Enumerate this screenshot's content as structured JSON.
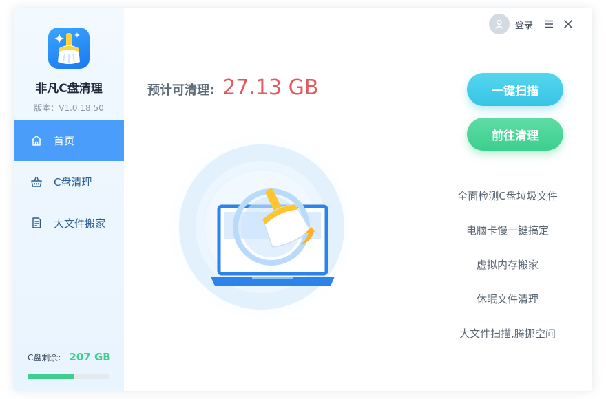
{
  "app": {
    "title": "非凡C盘清理",
    "version": "版本：V1.0.18.50"
  },
  "header": {
    "login_label": "登录",
    "menu_icon": "menu-icon",
    "close_icon": "close-icon"
  },
  "sidebar": {
    "items": [
      {
        "label": "首页",
        "icon": "home-icon",
        "active": true
      },
      {
        "label": "C盘清理",
        "icon": "basket-icon",
        "active": false
      },
      {
        "label": "大文件搬家",
        "icon": "document-icon",
        "active": false
      }
    ],
    "disk": {
      "label": "C盘剩余:",
      "value": "207 GB",
      "used_fraction": 0.57
    }
  },
  "main": {
    "estimate_label": "预计可清理:",
    "estimate_value": "27.13 GB",
    "scan_button": "一键扫描",
    "clean_button": "前往清理",
    "features": [
      "全面检测C盘垃圾文件",
      "电脑卡慢一键搞定",
      "虚拟内存搬家",
      "休眠文件清理",
      "大文件扫描,腾挪空间"
    ]
  },
  "colors": {
    "accent_blue": "#4a9dfb",
    "estimate_red": "#e2595f",
    "scan_cyan": "#38c4e6",
    "clean_green": "#3ccf8e"
  }
}
